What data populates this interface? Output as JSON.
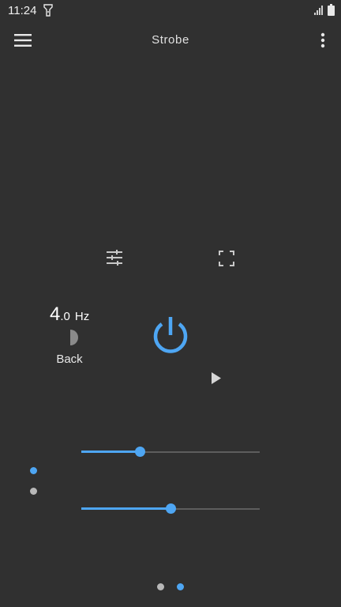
{
  "status_bar": {
    "time": "11:24",
    "icons": [
      "flashlight-icon",
      "signal-icon",
      "battery-icon"
    ]
  },
  "app_bar": {
    "title": "Strobe",
    "left_icon": "menu-icon",
    "right_icon": "overflow-menu-icon"
  },
  "toolbar": {
    "icons": [
      "settings-sliders-icon",
      "fullscreen-icon"
    ]
  },
  "frequency": {
    "integer": "4",
    "decimal": ".0",
    "unit": "Hz"
  },
  "back": {
    "label": "Back",
    "icon": "half-moon-icon"
  },
  "controls": {
    "power_icon": "power-icon",
    "play_icon": "play-icon"
  },
  "sliders": [
    {
      "name": "slider-1",
      "value": 0.33
    },
    {
      "name": "slider-2",
      "value": 0.5
    }
  ],
  "slider_indicators": {
    "active_index": 0,
    "count": 2
  },
  "page_indicator": {
    "count": 2,
    "active_index": 1
  },
  "colors": {
    "background": "#303030",
    "accent": "#4ea6f3",
    "track": "#5d5d5d",
    "inactive_dot": "#b8b8b8"
  }
}
